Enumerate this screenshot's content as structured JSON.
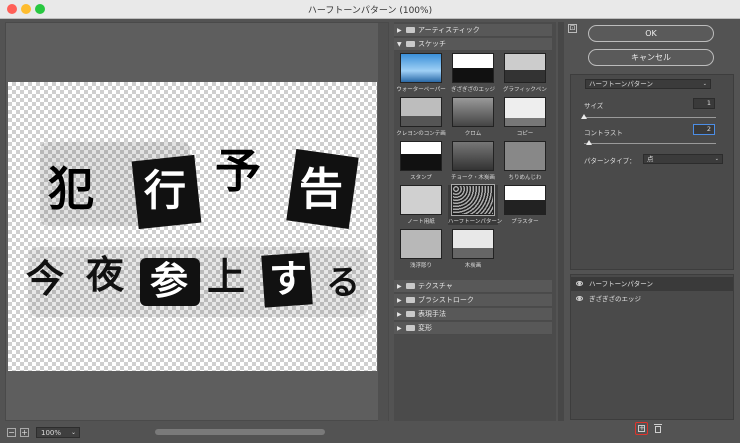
{
  "window": {
    "title": "ハーフトーンパターン (100%)"
  },
  "preview": {
    "artwork_lines": [
      [
        "犯",
        "行",
        "予",
        "告"
      ],
      [
        "今",
        "夜",
        "参",
        "上",
        "す",
        "る"
      ]
    ],
    "zoom": "100%",
    "zoom_out": "−",
    "zoom_in": "+"
  },
  "gallery": {
    "categories": [
      {
        "label": "アーティスティック",
        "expanded": false
      },
      {
        "label": "スケッチ",
        "expanded": true
      },
      {
        "label": "テクスチャ",
        "expanded": false
      },
      {
        "label": "ブラシストローク",
        "expanded": false
      },
      {
        "label": "表現手法",
        "expanded": false
      },
      {
        "label": "変形",
        "expanded": false
      }
    ],
    "thumbnails": [
      "ウォーターペーパー",
      "ぎざぎざのエッジ",
      "グラフィックペン",
      "クレヨンのコンテ画",
      "クロム",
      "コピー",
      "スタンプ",
      "チョーク・木炭画",
      "ちりめんじわ",
      "ノート用紙",
      "ハーフトーンパターン",
      "プラスター",
      "浅浮彫り",
      "木炭画"
    ],
    "selected_thumbnail": "ハーフトーンパターン"
  },
  "right": {
    "ok_label": "OK",
    "cancel_label": "キャンセル",
    "filter_select": "ハーフトーンパターン",
    "size_label": "サイズ",
    "size_value": "1",
    "size_level": 0.0,
    "contrast_label": "コントラスト",
    "contrast_value": "2",
    "contrast_level": 0.04,
    "pattern_type_label": "パターンタイプ：",
    "pattern_type_value": "点"
  },
  "layers": [
    {
      "name": "ハーフトーンパターン",
      "selected": true
    },
    {
      "name": "ぎざぎざのエッジ",
      "selected": false
    }
  ],
  "icons": {
    "expand_icon": "⊡",
    "new_layer_icon": "+",
    "triangle_open": "▼",
    "triangle_closed": "▶",
    "chevron": "⌄"
  }
}
